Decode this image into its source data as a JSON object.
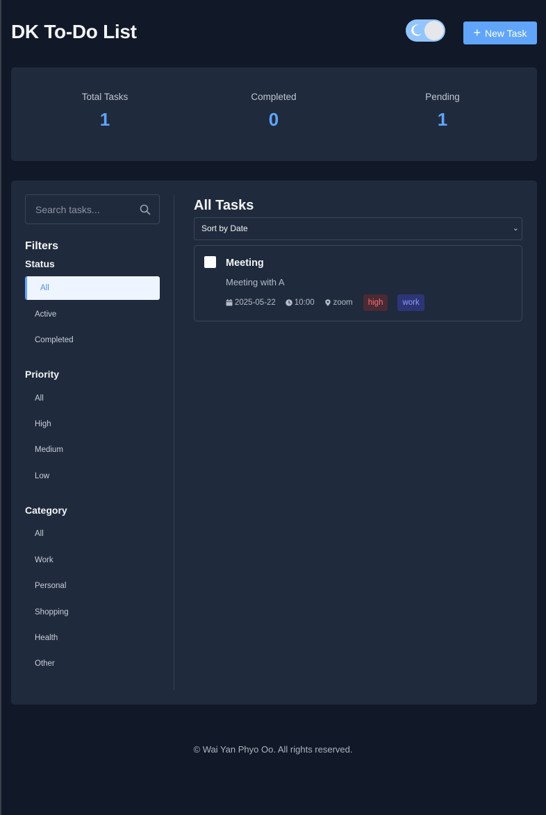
{
  "header": {
    "title": "DK To-Do List",
    "new_task_label": "New Task",
    "theme_toggle_icon": "moon-icon"
  },
  "stats": [
    {
      "label": "Total Tasks",
      "value": "1"
    },
    {
      "label": "Completed",
      "value": "0"
    },
    {
      "label": "Pending",
      "value": "1"
    }
  ],
  "sidebar": {
    "search_placeholder": "Search tasks...",
    "filters_title": "Filters",
    "status": {
      "title": "Status",
      "items": [
        "All",
        "Active",
        "Completed"
      ],
      "active": "All"
    },
    "priority": {
      "title": "Priority",
      "items": [
        "All",
        "High",
        "Medium",
        "Low"
      ]
    },
    "category": {
      "title": "Category",
      "items": [
        "All",
        "Work",
        "Personal",
        "Shopping",
        "Health",
        "Other"
      ]
    }
  },
  "main": {
    "title": "All Tasks",
    "sort_selected": "Sort by Date",
    "tasks": [
      {
        "title": "Meeting",
        "description": "Meeting with A",
        "date": "2025-05-22",
        "time": "10:00",
        "location": "zoom",
        "priority": "high",
        "category": "work",
        "completed": false
      }
    ]
  },
  "footer": {
    "text": "© Wai Yan Phyo Oo. All rights reserved."
  },
  "colors": {
    "background": "#111827",
    "card": "#1f2a3c",
    "accent": "#60a5fa",
    "priority_high": "#f87171",
    "category_work": "#8b9cf7"
  }
}
